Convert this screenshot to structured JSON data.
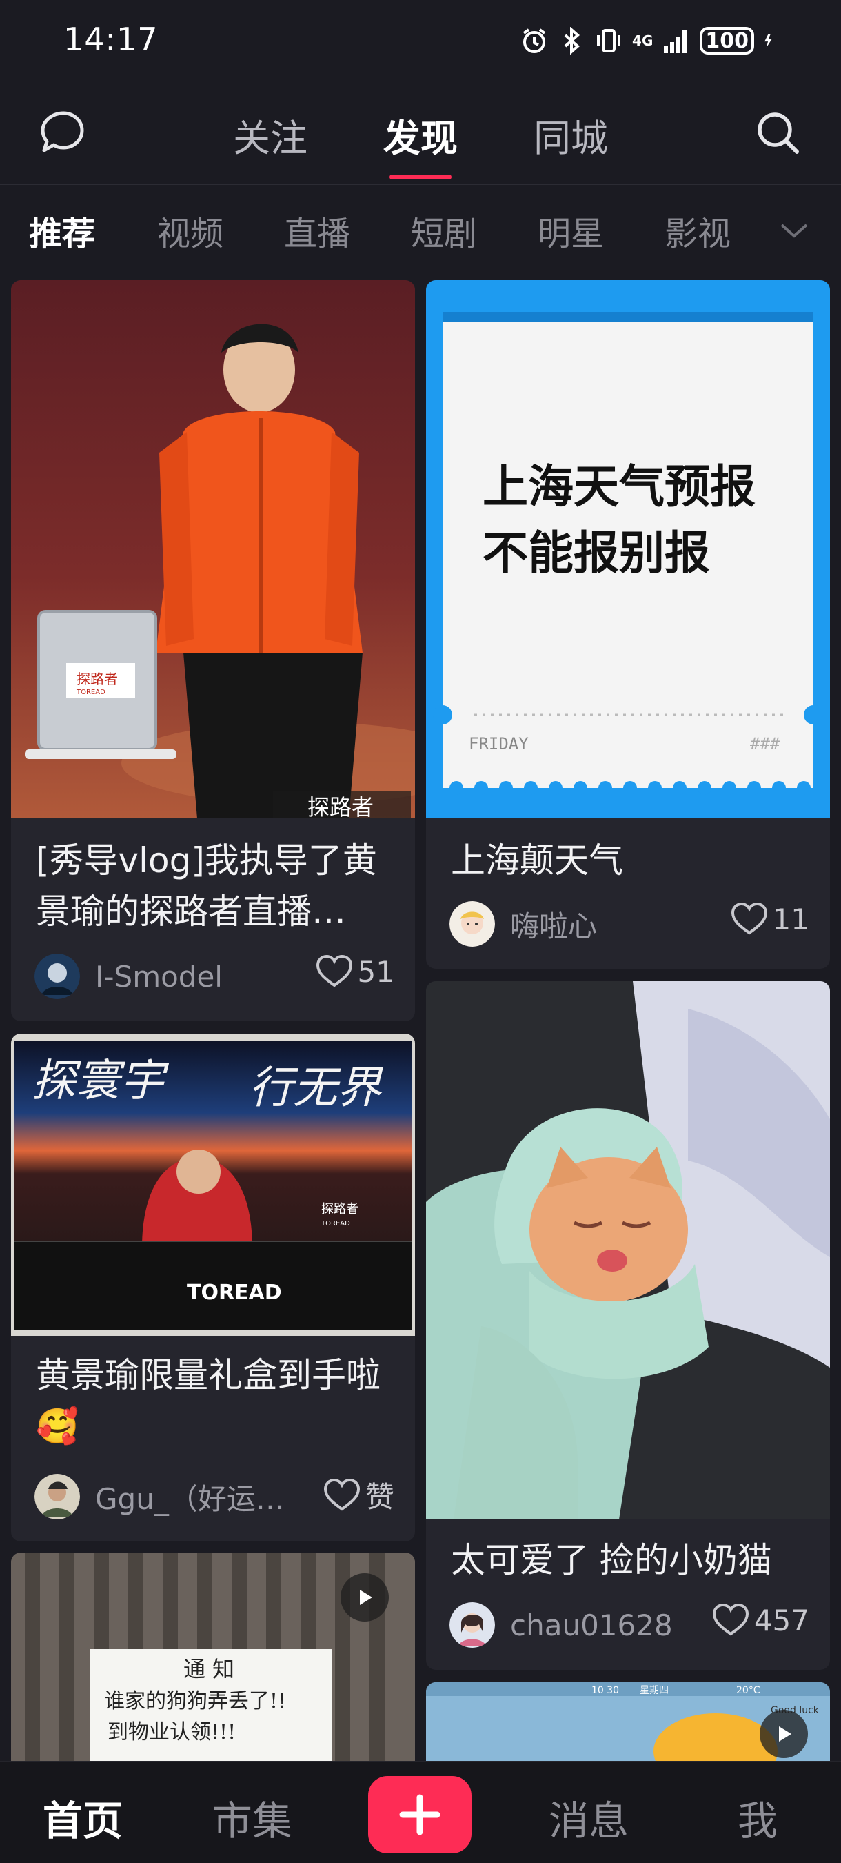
{
  "status": {
    "time": "14:17",
    "network": "4G",
    "battery": "100"
  },
  "topnav": {
    "tabs": [
      {
        "label": "关注"
      },
      {
        "label": "发现"
      },
      {
        "label": "同城"
      }
    ]
  },
  "subtabs": [
    "推荐",
    "视频",
    "直播",
    "短剧",
    "明星",
    "影视"
  ],
  "feed": {
    "left": [
      {
        "title": "[秀导vlog]我执导了黄景瑜的探路者直播…",
        "author": "I-Smodel",
        "likes": "51",
        "thumb_text": {
          "brand_box": "探路者",
          "brand_box_sub": "TOREAD",
          "bottom": "探路者"
        }
      },
      {
        "title": "黄景瑜限量礼盒到手啦🥰",
        "author": "Ggu_（好运…",
        "likes": "赞",
        "thumb_text": {
          "slogan_left": "探寰宇",
          "slogan_right": "行无界",
          "logo": "TOREAD",
          "logo_small": "探路者",
          "logo_small_sub": "TOREAD"
        }
      },
      {
        "title": "",
        "author": "",
        "likes": "",
        "thumb_text": {
          "notice_title": "通 知",
          "notice_line1": "谁家的狗狗弄丢了!!",
          "notice_line2": "到物业认领!!!"
        }
      }
    ],
    "right": [
      {
        "title": "上海颠天气",
        "author": "嗨啦心",
        "likes": "11",
        "thumb_text": {
          "headline1": "上海天气预报",
          "headline2": "不能报别报",
          "day": "FRIDAY",
          "hash": "###"
        }
      },
      {
        "title": "太可爱了 捡的小奶猫",
        "author": "chau01628",
        "likes": "457",
        "thumb_text": {}
      },
      {
        "title": "",
        "author": "",
        "likes": "",
        "thumb_text": {
          "clock": "10 30",
          "weekday": "星期四",
          "temp": "20°C",
          "sticker": "Good luck"
        }
      }
    ]
  },
  "bottomnav": {
    "items": [
      "首页",
      "市集",
      "消息",
      "我"
    ]
  },
  "colors": {
    "accent": "#fe2c55",
    "background": "#1b1b22",
    "card": "#25252d"
  }
}
